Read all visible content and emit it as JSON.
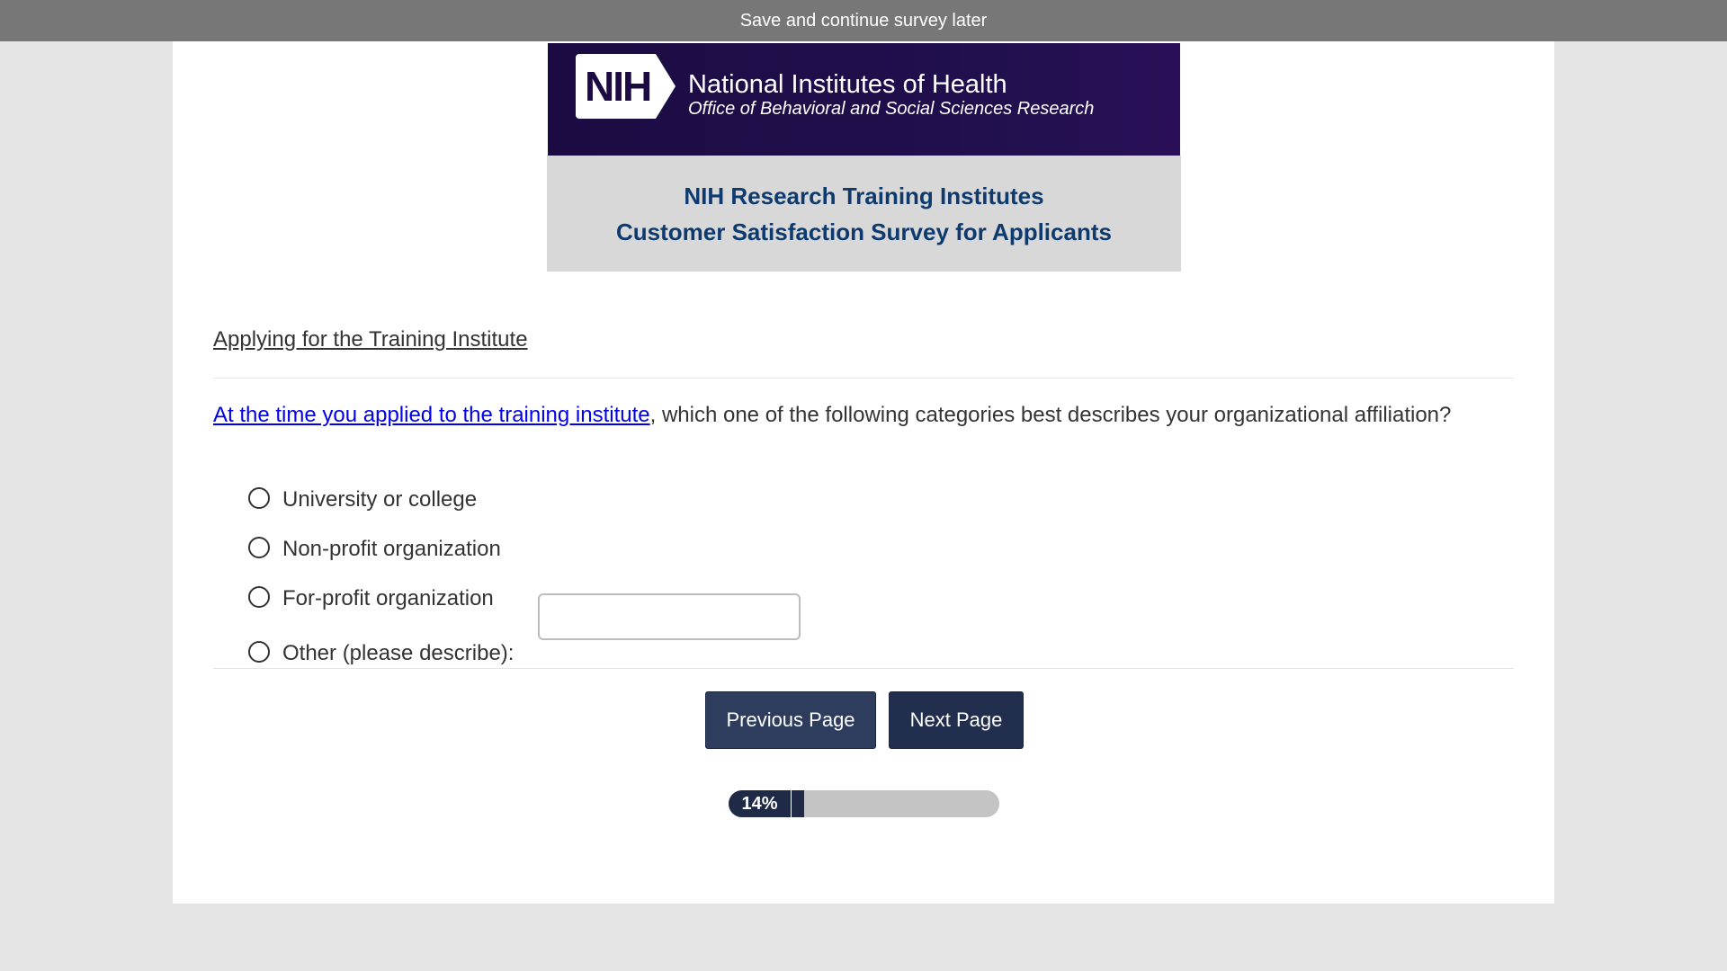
{
  "topbar": {
    "label": "Save and continue survey later"
  },
  "banner": {
    "logo_mark": "NIH",
    "org_name": "National Institutes of Health",
    "office_name": "Office of Behavioral and Social Sciences Research",
    "colors": {
      "banner_bg": "#1c0b42",
      "title_text": "#0e3a6e"
    }
  },
  "survey": {
    "title_line1": "NIH Research Training Institutes",
    "title_line2": "Customer Satisfaction Survey for Applicants"
  },
  "section": {
    "title": "Applying for the Training Institute"
  },
  "question": {
    "link_text": "At the time you applied to the training institute",
    "text": ", which one of the following categories best describes your organizational affiliation?",
    "options": [
      {
        "label": "University or college",
        "selected": false
      },
      {
        "label": "Non-profit organization",
        "selected": false
      },
      {
        "label": "For-profit organization",
        "selected": false
      },
      {
        "label": "Other (please describe):",
        "selected": false
      }
    ],
    "other_value": ""
  },
  "nav": {
    "previous_label": "Previous Page",
    "next_label": "Next Page"
  },
  "progress": {
    "label": "14%",
    "value": 0.14,
    "colors": {
      "fill": "#1f2a47",
      "track": "#c4c4c4"
    }
  }
}
